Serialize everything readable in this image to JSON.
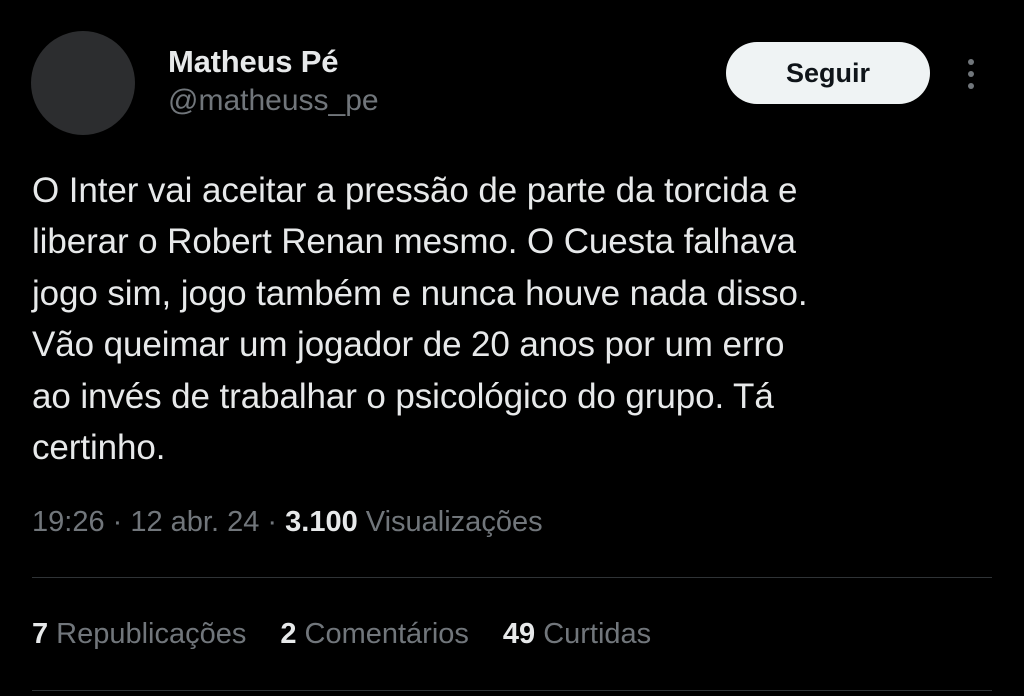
{
  "author": {
    "name": "Matheus Pé",
    "handle": "@matheuss_pe"
  },
  "follow_label": "Seguir",
  "tweet": {
    "text": "O Inter vai aceitar a pressão de parte da torcida e\nliberar o Robert Renan mesmo. O Cuesta falhava\njogo sim, jogo também e nunca houve nada disso.\nVão queimar um jogador de 20 anos por um erro\nao invés de trabalhar o psicológico do grupo. Tá\ncertinho."
  },
  "meta": {
    "time": "19:26",
    "separator": " · ",
    "date": "12 abr. 24",
    "views_count": "3.100",
    "views_label": "Visualizações"
  },
  "stats": [
    {
      "count": "7",
      "label": "Republicações"
    },
    {
      "count": "2",
      "label": "Comentários"
    },
    {
      "count": "49",
      "label": "Curtidas"
    }
  ],
  "icons": {
    "more": "more-vertical-icon"
  },
  "colors": {
    "background": "#000000",
    "text_primary": "#e7e9ea",
    "text_secondary": "#71767b",
    "follow_button_bg": "#eff3f4",
    "divider": "#2f3336"
  }
}
